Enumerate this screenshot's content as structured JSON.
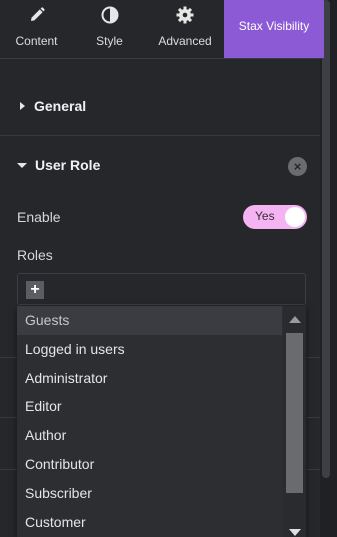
{
  "tabs": [
    {
      "label": "Content",
      "icon": "pencil-icon"
    },
    {
      "label": "Style",
      "icon": "half-circle-icon"
    },
    {
      "label": "Advanced",
      "icon": "gear-icon"
    },
    {
      "label": "Stax Visibility",
      "icon": ""
    }
  ],
  "sections": {
    "general": {
      "title": "General"
    },
    "user_role": {
      "title": "User Role"
    }
  },
  "enable": {
    "label": "Enable",
    "toggle_text": "Yes",
    "value": true
  },
  "roles": {
    "label": "Roles",
    "options": [
      "Guests",
      "Logged in users",
      "Administrator",
      "Editor",
      "Author",
      "Contributor",
      "Subscriber",
      "Customer"
    ]
  },
  "colors": {
    "accent": "#8d5ad6",
    "toggle": "#f4b3f1",
    "background": "#26272b"
  }
}
